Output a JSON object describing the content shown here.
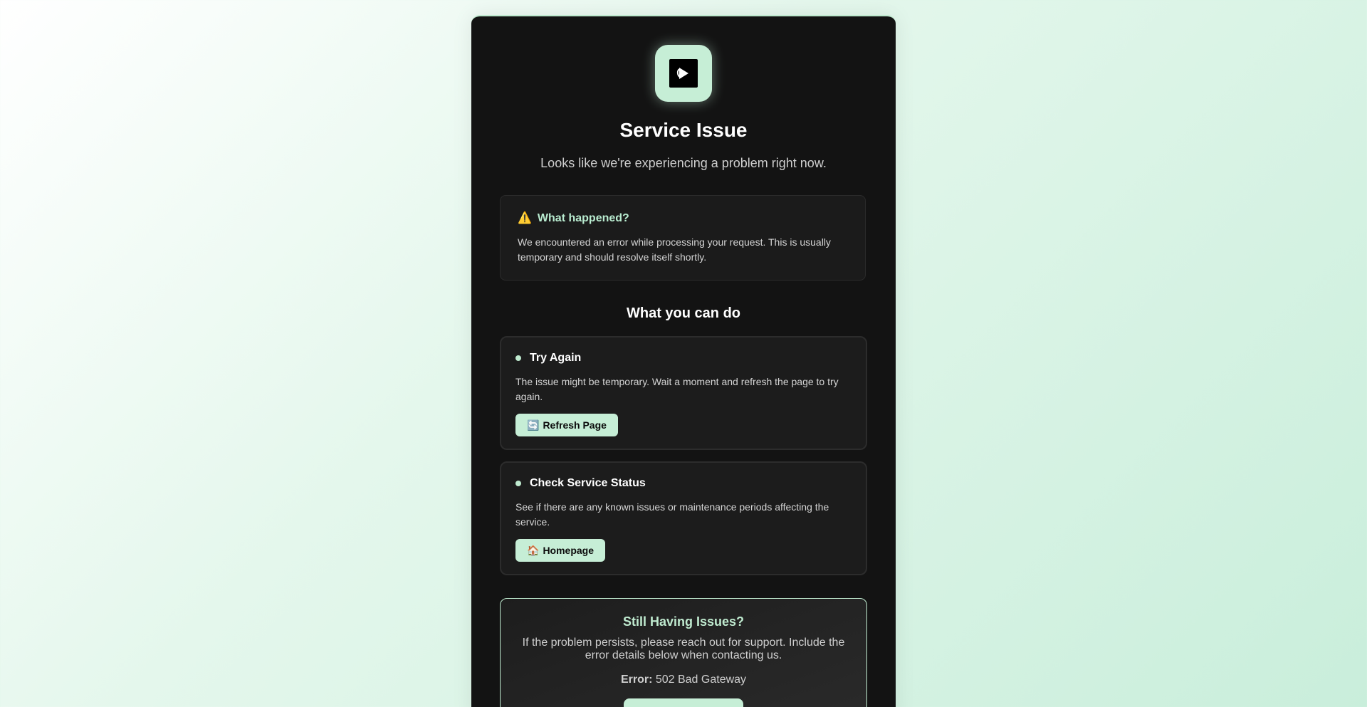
{
  "header": {
    "logo_icon": "play-in-box-icon",
    "title": "Service Issue",
    "subtitle": "Looks like we're experiencing a problem right now."
  },
  "info": {
    "icon": "⚠️",
    "heading": "What happened?",
    "text": "We encountered an error while processing your request. This is usually temporary and should resolve itself shortly."
  },
  "actions": {
    "section_title": "What you can do",
    "items": [
      {
        "title": "Try Again",
        "text": "The issue might be temporary. Wait a moment and refresh the page to try again.",
        "button_icon": "🔄",
        "button_label": "Refresh Page"
      },
      {
        "title": "Check Service Status",
        "text": "See if there are any known issues or maintenance periods affecting the service.",
        "button_icon": "🏠",
        "button_label": "Homepage"
      }
    ]
  },
  "support": {
    "title": "Still Having Issues?",
    "text": "If the problem persists, please reach out for support. Include the error details below when contacting us.",
    "error_label": "Error:",
    "error_value": "502 Bad Gateway"
  },
  "colors": {
    "accent": "#c6eed6",
    "card_bg": "#131313",
    "text_muted": "#cfcfcf"
  }
}
